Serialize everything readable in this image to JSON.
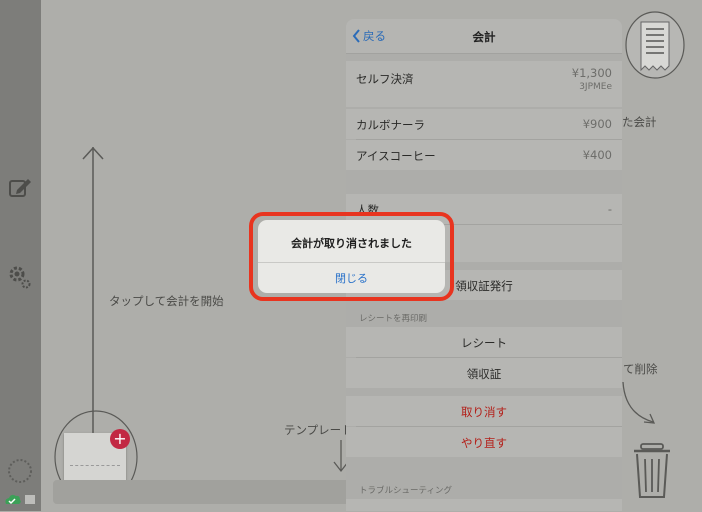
{
  "sidebar": {
    "icons": [
      "edit-icon",
      "settings-icon",
      "spinner-icon",
      "cloud-icon"
    ]
  },
  "hints": {
    "tap_to_start": "タップして会計を開始",
    "template": "テンプレート",
    "to_delete": "て削除",
    "receipt_partial": "た会計"
  },
  "popover": {
    "back_label": "戻る",
    "title": "会計",
    "self_checkout": {
      "label": "セルフ決済",
      "amount": "¥1,300",
      "code": "3JPMEe"
    },
    "items": [
      {
        "name": "カルボナーラ",
        "price": "¥900"
      },
      {
        "name": "アイスコーヒー",
        "price": "¥400"
      }
    ],
    "people": {
      "label": "人数",
      "value": "-"
    },
    "issue_receipt": "領収証発行",
    "reprint_section": "レシートを再印刷",
    "reprint_receipt": "レシート",
    "reprint_invoice": "領収証",
    "cancel": "取り消す",
    "redo": "やり直す",
    "troubleshooting": "トラブルシューティング"
  },
  "dialog": {
    "message": "会計が取り消されました",
    "close_button": "閉じる"
  },
  "colors": {
    "accent_blue": "#2a72c9",
    "destructive_red": "#b3201a",
    "highlight_ring": "#e8341f"
  }
}
